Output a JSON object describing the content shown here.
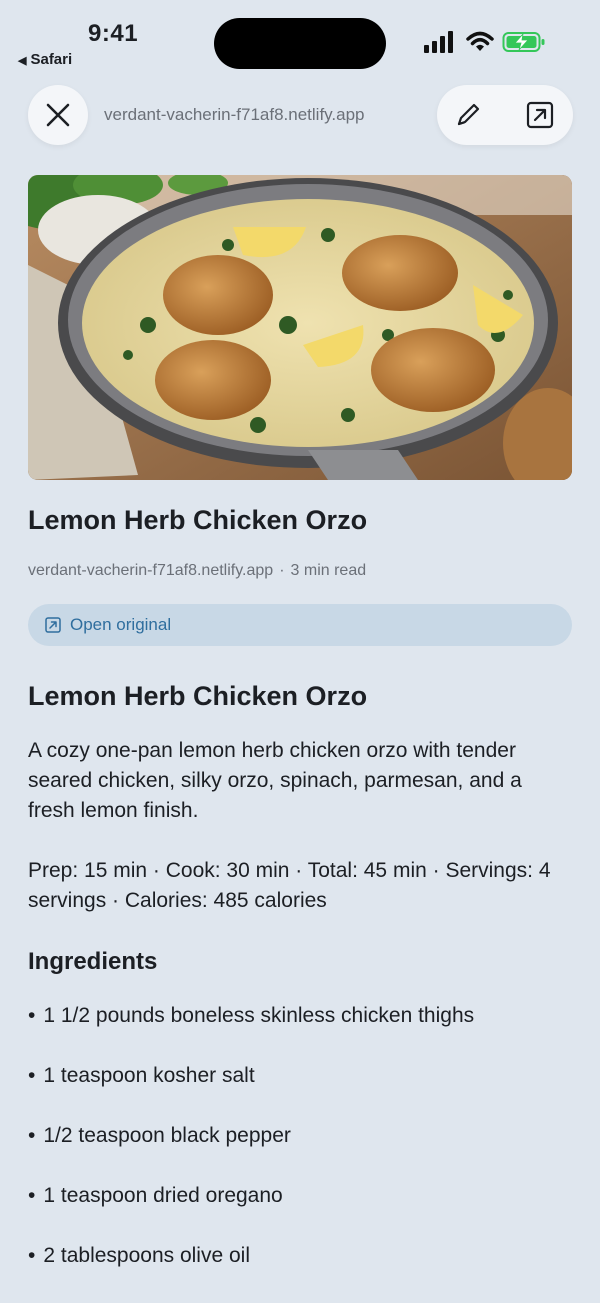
{
  "status_bar": {
    "time": "9:41",
    "back_app": "Safari",
    "signal_icon": "cellular-signal-icon",
    "wifi_icon": "wifi-icon",
    "battery_icon": "battery-charging-icon",
    "battery_color": "#34c759"
  },
  "toolbar": {
    "close_icon": "close-icon",
    "url": "verdant-vacherin-f71af8.netlify.app",
    "edit_icon": "pencil-icon",
    "open_external_icon": "open-external-icon"
  },
  "article": {
    "title": "Lemon Herb Chicken Orzo",
    "source": "verdant-vacherin-f71af8.netlify.app",
    "separator": "·",
    "read_time": "3 min read",
    "open_original_label": "Open original",
    "heading": "Lemon Herb Chicken Orzo",
    "description": "A cozy one-pan lemon herb chicken orzo with tender seared chicken, silky orzo, spinach, parmesan, and a fresh lemon finish.",
    "times": "Prep: 15 min · Cook: 30 min · Total: 45 min · Servings: 4 servings · Calories: 485 calories",
    "ingredients_heading": "Ingredients",
    "bullet": "•",
    "ingredients": [
      "1 1/2 pounds boneless skinless chicken thighs",
      "1 teaspoon kosher salt",
      "1/2 teaspoon black pepper",
      "1 teaspoon dried oregano",
      "2 tablespoons olive oil"
    ]
  },
  "colors": {
    "background": "#dfe6ee",
    "accent": "#2f6e9e",
    "pill_bg": "#c8d8e6"
  }
}
